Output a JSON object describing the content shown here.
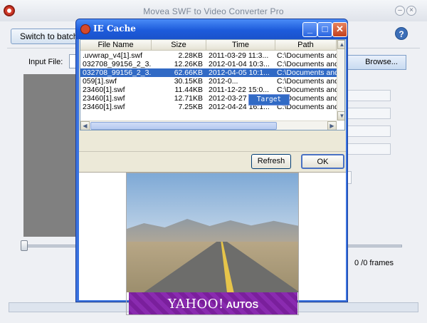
{
  "app": {
    "title": "Movea SWF to Video Converter Pro",
    "switch_label": "Switch to batch",
    "input_label": "Input File:",
    "browse_label": "Browse...",
    "frames_label": "0 /0 frames",
    "minimize_glyph": "–",
    "close_glyph": "×",
    "help_glyph": "?"
  },
  "dialog": {
    "title": "IE Cache",
    "min_glyph": "_",
    "max_glyph": "□",
    "close_glyph": "✕",
    "columns": [
      "File Name",
      "Size",
      "Time",
      "Path"
    ],
    "rows": [
      {
        "name": ".uvwrap_v4[1].swf",
        "size": "2.28KB",
        "time": "2011-03-29 11:3...",
        "path": "C:\\Documents and"
      },
      {
        "name": "032708_99156_2_3...",
        "size": "12.26KB",
        "time": "2012-01-04 10:3...",
        "path": "C:\\Documents and"
      },
      {
        "name": "032708_99156_2_3...",
        "size": "62.66KB",
        "time": "2012-04-05 10:1...",
        "path": "C:\\Documents and"
      },
      {
        "name": "059[1].swf",
        "size": "30.15KB",
        "time": "2012-0...",
        "path": "C:\\Documents and"
      },
      {
        "name": "23460[1].swf",
        "size": "11.44KB",
        "time": "2011-12-22 15:0...",
        "path": "C:\\Documents and"
      },
      {
        "name": "23460[1].swf",
        "size": "12.71KB",
        "time": "2012-03-27 09:0...",
        "path": "C:\\Documents and"
      },
      {
        "name": "23460[1].swf",
        "size": "7.25KB",
        "time": "2012-04-24 16:1...",
        "path": "C:\\Documents and"
      }
    ],
    "selected_row": 2,
    "context_menu": "Target",
    "refresh_label": "Refresh",
    "ok_label": "OK",
    "preview_brand": "YAHOO!",
    "preview_sub": "AUTOS"
  }
}
